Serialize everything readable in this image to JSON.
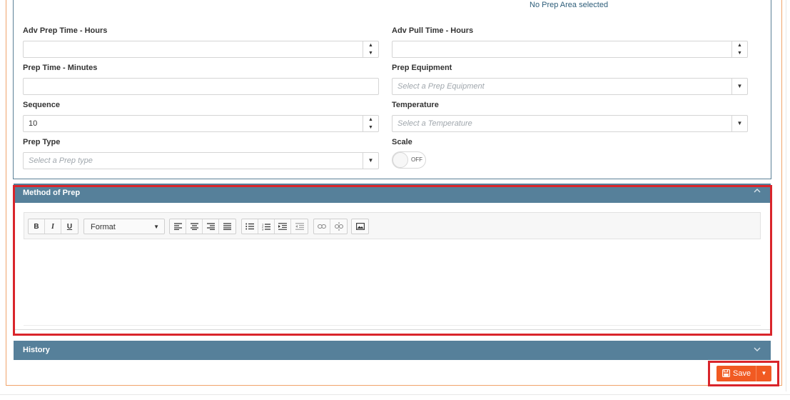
{
  "prep_area_status": "No Prep Area selected",
  "fields": {
    "adv_prep_time": {
      "label": "Adv Prep Time - Hours",
      "value": ""
    },
    "adv_pull_time": {
      "label": "Adv Pull Time - Hours",
      "value": ""
    },
    "prep_time_minutes": {
      "label": "Prep Time - Minutes",
      "value": ""
    },
    "prep_equipment": {
      "label": "Prep Equipment",
      "placeholder": "Select a Prep Equipment"
    },
    "sequence": {
      "label": "Sequence",
      "value": "10"
    },
    "temperature": {
      "label": "Temperature",
      "placeholder": "Select a Temperature"
    },
    "prep_type": {
      "label": "Prep Type",
      "placeholder": "Select a Prep type"
    },
    "scale": {
      "label": "Scale",
      "state": "OFF"
    }
  },
  "method_of_prep": {
    "title": "Method of Prep",
    "toolbar": {
      "bold": "B",
      "italic": "I",
      "underline": "U",
      "format_label": "Format"
    }
  },
  "history": {
    "title": "History"
  },
  "save": {
    "label": "Save"
  },
  "colors": {
    "section_header": "#56809a",
    "save_button": "#f15a22",
    "highlight": "#d9252b",
    "frame": "#f0a36a"
  },
  "icons": {
    "align": [
      "align-left-icon",
      "align-center-icon",
      "align-right-icon",
      "align-justify-icon"
    ],
    "lists": [
      "bullet-list-icon",
      "numbered-list-icon",
      "indent-icon",
      "outdent-icon"
    ],
    "links": [
      "link-icon",
      "unlink-icon"
    ],
    "media": [
      "image-icon"
    ]
  }
}
